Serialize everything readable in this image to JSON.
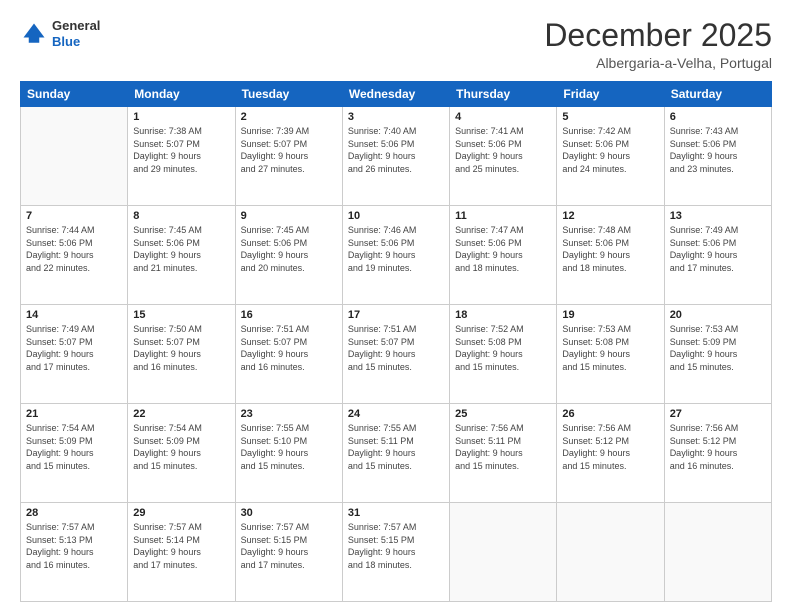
{
  "header": {
    "logo_line1": "General",
    "logo_line2": "Blue",
    "month": "December 2025",
    "location": "Albergaria-a-Velha, Portugal"
  },
  "days_of_week": [
    "Sunday",
    "Monday",
    "Tuesday",
    "Wednesday",
    "Thursday",
    "Friday",
    "Saturday"
  ],
  "weeks": [
    [
      {
        "day": "",
        "info": ""
      },
      {
        "day": "1",
        "info": "Sunrise: 7:38 AM\nSunset: 5:07 PM\nDaylight: 9 hours\nand 29 minutes."
      },
      {
        "day": "2",
        "info": "Sunrise: 7:39 AM\nSunset: 5:07 PM\nDaylight: 9 hours\nand 27 minutes."
      },
      {
        "day": "3",
        "info": "Sunrise: 7:40 AM\nSunset: 5:06 PM\nDaylight: 9 hours\nand 26 minutes."
      },
      {
        "day": "4",
        "info": "Sunrise: 7:41 AM\nSunset: 5:06 PM\nDaylight: 9 hours\nand 25 minutes."
      },
      {
        "day": "5",
        "info": "Sunrise: 7:42 AM\nSunset: 5:06 PM\nDaylight: 9 hours\nand 24 minutes."
      },
      {
        "day": "6",
        "info": "Sunrise: 7:43 AM\nSunset: 5:06 PM\nDaylight: 9 hours\nand 23 minutes."
      }
    ],
    [
      {
        "day": "7",
        "info": "Sunrise: 7:44 AM\nSunset: 5:06 PM\nDaylight: 9 hours\nand 22 minutes."
      },
      {
        "day": "8",
        "info": "Sunrise: 7:45 AM\nSunset: 5:06 PM\nDaylight: 9 hours\nand 21 minutes."
      },
      {
        "day": "9",
        "info": "Sunrise: 7:45 AM\nSunset: 5:06 PM\nDaylight: 9 hours\nand 20 minutes."
      },
      {
        "day": "10",
        "info": "Sunrise: 7:46 AM\nSunset: 5:06 PM\nDaylight: 9 hours\nand 19 minutes."
      },
      {
        "day": "11",
        "info": "Sunrise: 7:47 AM\nSunset: 5:06 PM\nDaylight: 9 hours\nand 18 minutes."
      },
      {
        "day": "12",
        "info": "Sunrise: 7:48 AM\nSunset: 5:06 PM\nDaylight: 9 hours\nand 18 minutes."
      },
      {
        "day": "13",
        "info": "Sunrise: 7:49 AM\nSunset: 5:06 PM\nDaylight: 9 hours\nand 17 minutes."
      }
    ],
    [
      {
        "day": "14",
        "info": "Sunrise: 7:49 AM\nSunset: 5:07 PM\nDaylight: 9 hours\nand 17 minutes."
      },
      {
        "day": "15",
        "info": "Sunrise: 7:50 AM\nSunset: 5:07 PM\nDaylight: 9 hours\nand 16 minutes."
      },
      {
        "day": "16",
        "info": "Sunrise: 7:51 AM\nSunset: 5:07 PM\nDaylight: 9 hours\nand 16 minutes."
      },
      {
        "day": "17",
        "info": "Sunrise: 7:51 AM\nSunset: 5:07 PM\nDaylight: 9 hours\nand 15 minutes."
      },
      {
        "day": "18",
        "info": "Sunrise: 7:52 AM\nSunset: 5:08 PM\nDaylight: 9 hours\nand 15 minutes."
      },
      {
        "day": "19",
        "info": "Sunrise: 7:53 AM\nSunset: 5:08 PM\nDaylight: 9 hours\nand 15 minutes."
      },
      {
        "day": "20",
        "info": "Sunrise: 7:53 AM\nSunset: 5:09 PM\nDaylight: 9 hours\nand 15 minutes."
      }
    ],
    [
      {
        "day": "21",
        "info": "Sunrise: 7:54 AM\nSunset: 5:09 PM\nDaylight: 9 hours\nand 15 minutes."
      },
      {
        "day": "22",
        "info": "Sunrise: 7:54 AM\nSunset: 5:09 PM\nDaylight: 9 hours\nand 15 minutes."
      },
      {
        "day": "23",
        "info": "Sunrise: 7:55 AM\nSunset: 5:10 PM\nDaylight: 9 hours\nand 15 minutes."
      },
      {
        "day": "24",
        "info": "Sunrise: 7:55 AM\nSunset: 5:11 PM\nDaylight: 9 hours\nand 15 minutes."
      },
      {
        "day": "25",
        "info": "Sunrise: 7:56 AM\nSunset: 5:11 PM\nDaylight: 9 hours\nand 15 minutes."
      },
      {
        "day": "26",
        "info": "Sunrise: 7:56 AM\nSunset: 5:12 PM\nDaylight: 9 hours\nand 15 minutes."
      },
      {
        "day": "27",
        "info": "Sunrise: 7:56 AM\nSunset: 5:12 PM\nDaylight: 9 hours\nand 16 minutes."
      }
    ],
    [
      {
        "day": "28",
        "info": "Sunrise: 7:57 AM\nSunset: 5:13 PM\nDaylight: 9 hours\nand 16 minutes."
      },
      {
        "day": "29",
        "info": "Sunrise: 7:57 AM\nSunset: 5:14 PM\nDaylight: 9 hours\nand 17 minutes."
      },
      {
        "day": "30",
        "info": "Sunrise: 7:57 AM\nSunset: 5:15 PM\nDaylight: 9 hours\nand 17 minutes."
      },
      {
        "day": "31",
        "info": "Sunrise: 7:57 AM\nSunset: 5:15 PM\nDaylight: 9 hours\nand 18 minutes."
      },
      {
        "day": "",
        "info": ""
      },
      {
        "day": "",
        "info": ""
      },
      {
        "day": "",
        "info": ""
      }
    ]
  ]
}
